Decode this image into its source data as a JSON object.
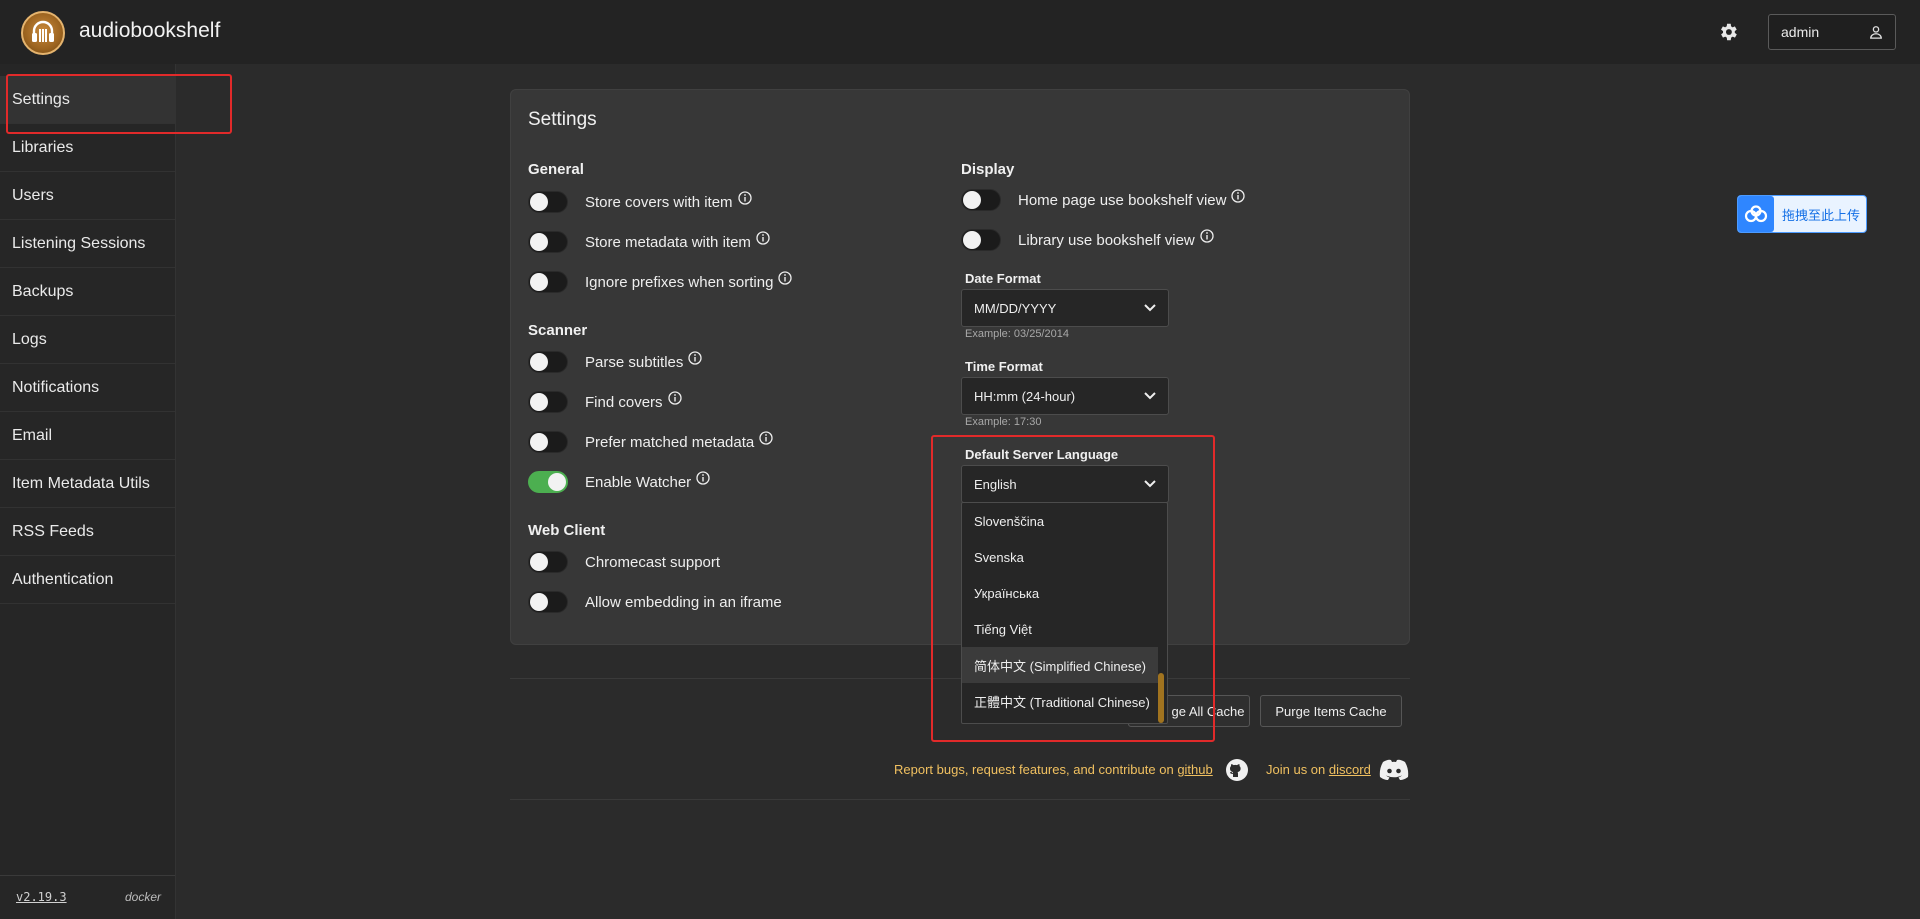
{
  "app": {
    "title": "audiobookshelf"
  },
  "header": {
    "username": "admin"
  },
  "sidebar": {
    "items": [
      {
        "label": "Settings"
      },
      {
        "label": "Libraries"
      },
      {
        "label": "Users"
      },
      {
        "label": "Listening Sessions"
      },
      {
        "label": "Backups"
      },
      {
        "label": "Logs"
      },
      {
        "label": "Notifications"
      },
      {
        "label": "Email"
      },
      {
        "label": "Item Metadata Utils"
      },
      {
        "label": "RSS Feeds"
      },
      {
        "label": "Authentication"
      }
    ],
    "version": "v2.19.3",
    "source": "docker"
  },
  "settings": {
    "title": "Settings",
    "general": {
      "title": "General",
      "toggles": [
        {
          "label": "Store covers with item",
          "on": false
        },
        {
          "label": "Store metadata with item",
          "on": false
        },
        {
          "label": "Ignore prefixes when sorting",
          "on": false
        }
      ]
    },
    "scanner": {
      "title": "Scanner",
      "toggles": [
        {
          "label": "Parse subtitles",
          "on": false
        },
        {
          "label": "Find covers",
          "on": false
        },
        {
          "label": "Prefer matched metadata",
          "on": false
        },
        {
          "label": "Enable Watcher",
          "on": true
        }
      ]
    },
    "web_client": {
      "title": "Web Client",
      "toggles": [
        {
          "label": "Chromecast support",
          "on": false
        },
        {
          "label": "Allow embedding in an iframe",
          "on": false
        }
      ]
    },
    "display": {
      "title": "Display",
      "toggles": [
        {
          "label": "Home page use bookshelf view",
          "on": false
        },
        {
          "label": "Library use bookshelf view",
          "on": false
        }
      ],
      "date_format": {
        "label": "Date Format",
        "value": "MM/DD/YYYY",
        "example": "Example: 03/25/2014"
      },
      "time_format": {
        "label": "Time Format",
        "value": "HH:mm (24-hour)",
        "example": "Example: 17:30"
      },
      "language": {
        "label": "Default Server Language",
        "value": "English",
        "options": [
          "Slovenščina",
          "Svenska",
          "Українська",
          "Tiếng Việt",
          "简体中文 (Simplified Chinese)",
          "正體中文 (Traditional Chinese)"
        ]
      }
    }
  },
  "actions": {
    "purge_all_cache_partial": "ge All Cache",
    "purge_items_cache": "Purge Items Cache"
  },
  "footer": {
    "report_text": "Report bugs, request features, and contribute on",
    "github": "github",
    "join_text": "Join us on",
    "discord": "discord"
  },
  "upload_widget": {
    "label": "拖拽至此上传"
  },
  "colors": {
    "toggle_on": "#4caf50",
    "link": "#f0c060",
    "highlight": "#e12a2a"
  }
}
